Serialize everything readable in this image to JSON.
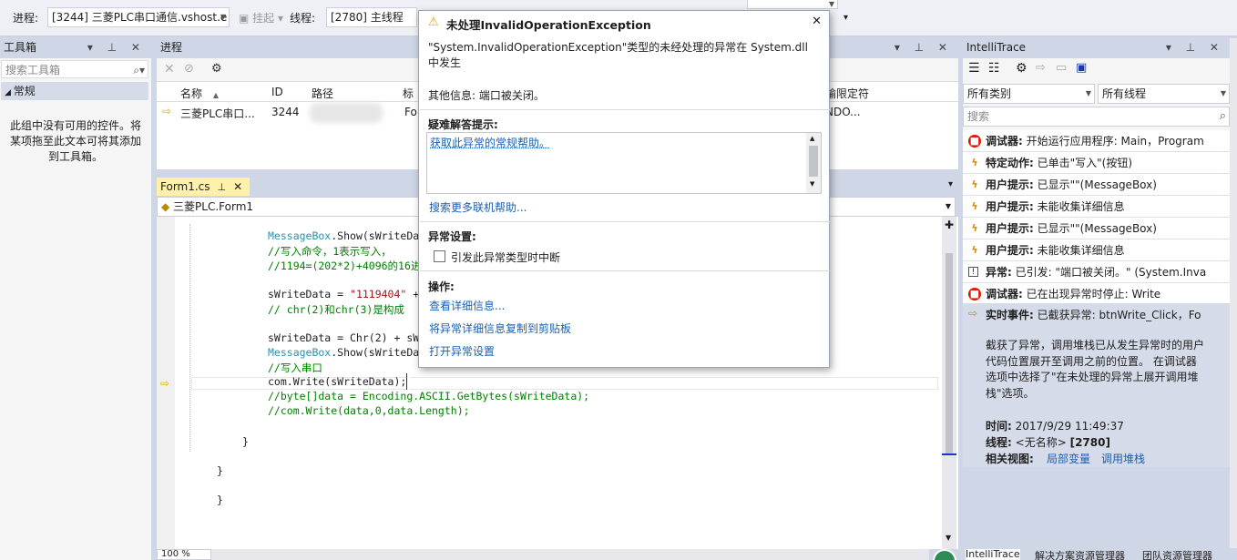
{
  "toolbar": {
    "process_label": "进程:",
    "process_value": "[3244] 三菱PLC串口通信.vshost.e",
    "suspend_label": "挂起",
    "thread_label": "线程:",
    "thread_value": "[2780] 主线程"
  },
  "toolbox": {
    "title": "工具箱",
    "search_placeholder": "搜索工具箱",
    "group": "常规",
    "empty_text": "此组中没有可用的控件。将某项拖至此文本可将其添加到工具箱。"
  },
  "process_panel": {
    "title": "进程",
    "columns": [
      "名称",
      "ID",
      "路径",
      "标",
      "输限定符"
    ],
    "row": {
      "name": "三菱PLC串口...",
      "id": "3244",
      "col4": "Fo",
      "col5": "NDO..."
    }
  },
  "editor": {
    "tab": "Form1.cs",
    "class_selector": "三菱PLC.Form1",
    "zoom": "100 %",
    "lines": [
      [
        {
          "t": "MessageBox",
          "c": "cls"
        },
        {
          "t": ".Show(sWriteDa",
          "c": "kw"
        }
      ],
      [
        {
          "t": "//写入命令，1表示写入，",
          "c": "cmt"
        }
      ],
      [
        {
          "t": "//1194=(202*2)+4096的16进",
          "c": "cmt"
        }
      ],
      [],
      [
        {
          "t": "sWriteData = ",
          "c": "kw"
        },
        {
          "t": "\"1119404\"",
          "c": "str"
        },
        {
          "t": " +",
          "c": "kw"
        }
      ],
      [
        {
          "t": "// chr(2)和chr(3)是构成",
          "c": "cmt"
        }
      ],
      [],
      [
        {
          "t": "sWriteData = Chr(2) + sW",
          "c": "kw"
        }
      ],
      [
        {
          "t": "MessageBox",
          "c": "cls"
        },
        {
          "t": ".Show(sWriteDa",
          "c": "kw"
        }
      ],
      [
        {
          "t": "//写入串口",
          "c": "cmt"
        }
      ],
      [
        {
          "t": "com.Write(sWriteData);",
          "c": "kw"
        }
      ],
      [
        {
          "t": "//byte[]data = Encoding.ASCII.GetBytes(sWriteData);",
          "c": "cmt"
        }
      ],
      [
        {
          "t": "//com.Write(data,0,data.Length);",
          "c": "cmt"
        }
      ]
    ],
    "braces": [
      "}",
      "}",
      "}"
    ]
  },
  "dialog": {
    "title": "未处理InvalidOperationException",
    "message": "\"System.InvalidOperationException\"类型的未经处理的异常在 System.dll 中发生",
    "additional": "其他信息: 端口被关闭。",
    "tips_heading": "疑难解答提示:",
    "tips_link": "获取此异常的常规帮助。",
    "more_help": "搜索更多联机帮助...",
    "settings_heading": "异常设置:",
    "break_checkbox": "引发此异常类型时中断",
    "actions_heading": "操作:",
    "actions": [
      "查看详细信息...",
      "将异常详细信息复制到剪贴板",
      "打开异常设置"
    ]
  },
  "intellitrace": {
    "title": "IntelliTrace",
    "category_filter": "所有类别",
    "thread_filter": "所有线程",
    "search_placeholder": "搜索",
    "events": [
      {
        "icon": "stop",
        "label": "调试器:",
        "text": "开始运行应用程序: Main，Program"
      },
      {
        "icon": "bolt",
        "label": "特定动作:",
        "text": "已单击\"写入\"(按钮)"
      },
      {
        "icon": "bolt",
        "label": "用户提示:",
        "text": "已显示\"\"(MessageBox)"
      },
      {
        "icon": "bolt",
        "label": "用户提示:",
        "text": "未能收集详细信息"
      },
      {
        "icon": "bolt",
        "label": "用户提示:",
        "text": "已显示\"\"(MessageBox)"
      },
      {
        "icon": "bolt",
        "label": "用户提示:",
        "text": "未能收集详细信息"
      },
      {
        "icon": "exc",
        "label": "异常:",
        "text": "已引发: \"端口被关闭。\" (System.Inva"
      },
      {
        "icon": "stop",
        "label": "调试器:",
        "text": "已在出现异常时停止: Write"
      }
    ],
    "selected": {
      "label": "实时事件:",
      "text": "已截获异常: btnWrite_Click，Fo",
      "desc": "截获了异常，调用堆栈已从发生异常时的用户代码位置展开至调用之前的位置。 在调试器选项中选择了\"在未处理的异常上展开调用堆栈\"选项。",
      "time_label": "时间:",
      "time_value": "2017/9/29 11:49:37",
      "thread_label": "线程:",
      "thread_value": "<无名称>",
      "thread_id": "[2780]",
      "views_label": "相关视图:",
      "view_locals": "局部变量",
      "view_callstack": "调用堆栈"
    }
  },
  "bottom_tabs": [
    "IntelliTrace",
    "解决方案资源管理器",
    "团队资源管理器"
  ]
}
